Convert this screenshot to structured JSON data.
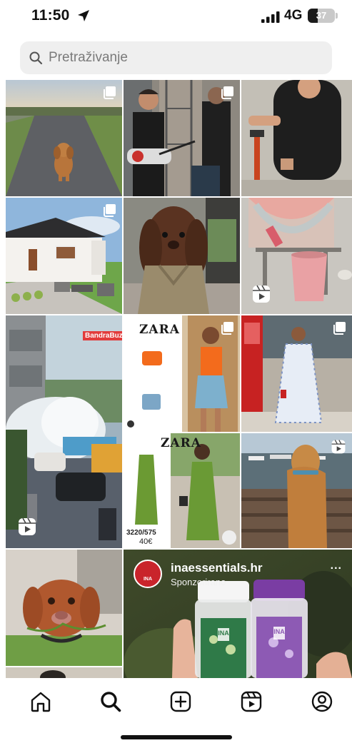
{
  "status_bar": {
    "time": "11:50",
    "location_icon": "location-arrow-icon",
    "signal_icon": "cellular-signal-icon",
    "network": "4G",
    "battery_level": "37"
  },
  "search": {
    "placeholder": "Pretraživanje",
    "icon": "search-icon"
  },
  "grid": {
    "tiles": [
      {
        "name": "dog-on-road",
        "badge": "multi-photo-icon"
      },
      {
        "name": "guitarist-band",
        "badge": "multi-photo-icon"
      },
      {
        "name": "pipe-toilet",
        "badge": "none"
      },
      {
        "name": "modern-house",
        "badge": "multi-photo-icon"
      },
      {
        "name": "dog-in-trench",
        "badge": "none"
      },
      {
        "name": "toilet-experiment",
        "badge": "reels-icon"
      },
      {
        "name": "water-burst-street",
        "badge": "reels-icon"
      },
      {
        "name": "zara-outfit-1",
        "badge": "multi-photo-icon"
      },
      {
        "name": "woman-floral-dress",
        "badge": "multi-photo-icon"
      },
      {
        "name": "zara-outfit-2",
        "badge": "none"
      },
      {
        "name": "dog-harbor",
        "badge": "reels-icon"
      },
      {
        "name": "vizsla-puppy",
        "badge": "none"
      }
    ],
    "overlay_texts": {
      "news_brand": "BandraBuzz",
      "zara_1": "ZARA",
      "zara_2": "ZARA",
      "zara_price": "3220/575",
      "zara_price_2": "40€"
    }
  },
  "ad": {
    "account": "inaessentials.hr",
    "sponsored": "Sponzorirano",
    "more": "...",
    "logo_text": "INA",
    "jar_1_label": "INA",
    "jar_2_label": "INA"
  },
  "nav": {
    "items": [
      {
        "name": "home",
        "icon": "home-icon"
      },
      {
        "name": "search",
        "icon": "search-icon"
      },
      {
        "name": "create",
        "icon": "plus-square-icon"
      },
      {
        "name": "reels",
        "icon": "reels-icon"
      },
      {
        "name": "profile",
        "icon": "profile-icon"
      }
    ],
    "active": "search"
  },
  "colors": {
    "search_bg": "#efefef",
    "ad_logo": "#c9242b",
    "text": "#111111"
  }
}
